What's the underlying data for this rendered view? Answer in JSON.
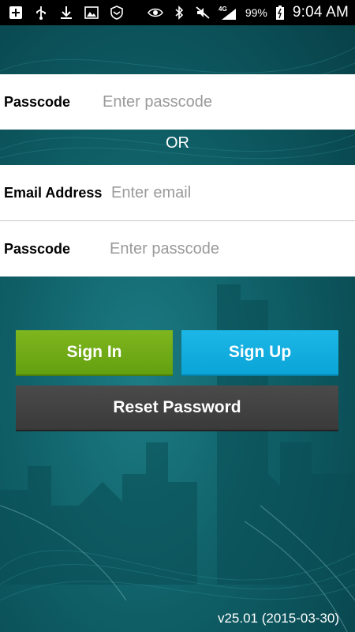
{
  "status_bar": {
    "left_icons": [
      "plus-box-icon",
      "usb-icon",
      "download-icon",
      "image-icon",
      "shield-icon"
    ],
    "right_icons": [
      "eye-icon",
      "bluetooth-icon",
      "mute-icon",
      "signal-4g-icon",
      "battery-icon"
    ],
    "network": "4G",
    "battery": "99%",
    "time": "9:04 AM"
  },
  "passcode_only": {
    "label": "Passcode",
    "placeholder": "Enter passcode",
    "value": ""
  },
  "separator": {
    "text": "OR"
  },
  "email": {
    "label": "Email Address",
    "placeholder": "Enter email",
    "value": ""
  },
  "passcode": {
    "label": "Passcode",
    "placeholder": "Enter passcode",
    "value": ""
  },
  "buttons": {
    "sign_in": "Sign In",
    "sign_up": "Sign Up",
    "reset_password": "Reset Password"
  },
  "colors": {
    "sign_in": "#71ad16",
    "sign_up": "#12aee0",
    "reset": "#414141",
    "background": "#0f5e66"
  },
  "version": "v25.01 (2015-03-30)"
}
